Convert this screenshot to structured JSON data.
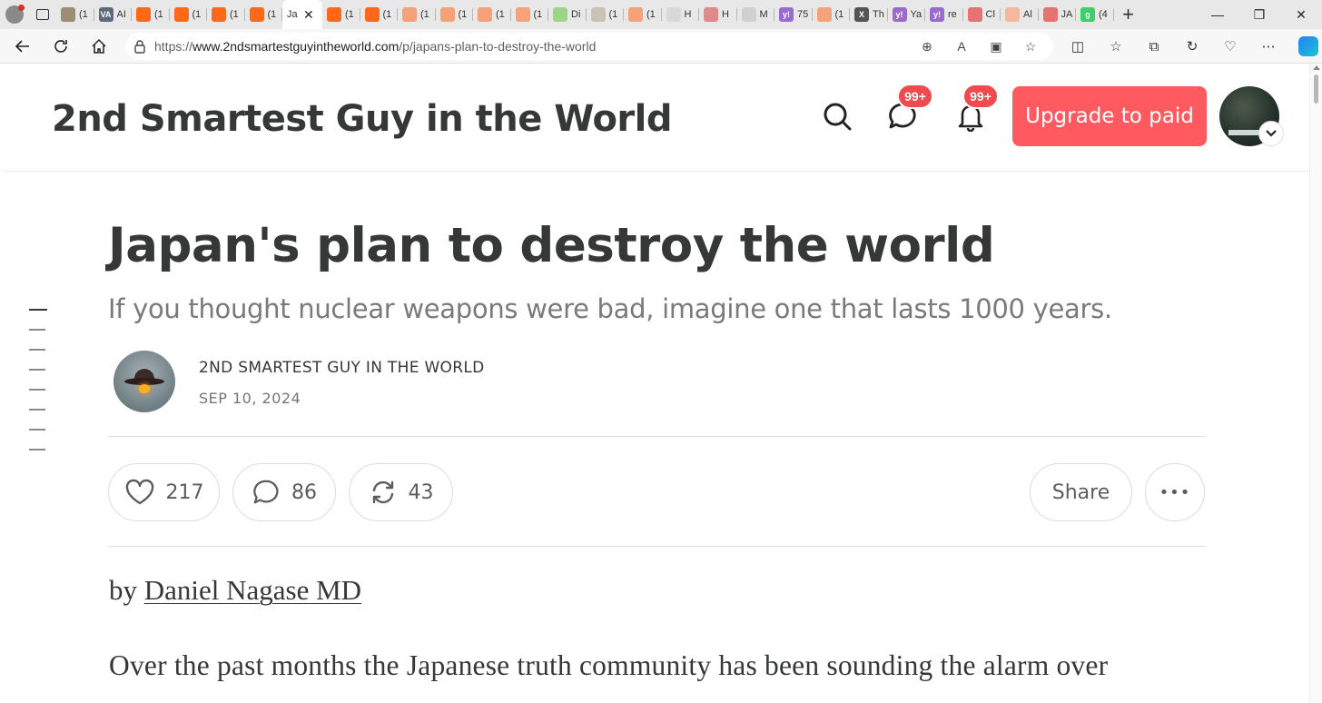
{
  "browser": {
    "tabs": [
      {
        "title": "(1",
        "favicon": "map-icon",
        "color": "#9a8f75"
      },
      {
        "title": "AI",
        "favicon": "va-icon",
        "color": "#5b6b7a",
        "text": "VA"
      },
      {
        "title": "(1",
        "favicon": "substack-icon",
        "color": "#ff6719"
      },
      {
        "title": "(1",
        "favicon": "substack-icon",
        "color": "#ff6719"
      },
      {
        "title": "(1",
        "favicon": "substack-icon",
        "color": "#ff6719"
      },
      {
        "title": "(1",
        "favicon": "substack-icon",
        "color": "#ff6719"
      },
      {
        "title": "Ja",
        "favicon": "",
        "color": "",
        "active": true
      },
      {
        "title": "(1",
        "favicon": "substack-icon",
        "color": "#ff6719"
      },
      {
        "title": "(1",
        "favicon": "substack-icon",
        "color": "#ff6719"
      },
      {
        "title": "(1",
        "favicon": "substack-icon",
        "color": "#f5a27a"
      },
      {
        "title": "(1",
        "favicon": "substack-icon",
        "color": "#f5a27a"
      },
      {
        "title": "(1",
        "favicon": "substack-icon",
        "color": "#f5a27a"
      },
      {
        "title": "(1",
        "favicon": "substack-icon",
        "color": "#f5a27a"
      },
      {
        "title": "Di",
        "favicon": "play-icon",
        "color": "#9cd48a"
      },
      {
        "title": "(1",
        "favicon": "person-icon",
        "color": "#c9c2b5"
      },
      {
        "title": "(1",
        "favicon": "substack-icon",
        "color": "#f5a27a"
      },
      {
        "title": "H",
        "favicon": "page-icon",
        "color": "#d8d8d8"
      },
      {
        "title": "H",
        "favicon": "video-icon",
        "color": "#e08a8a"
      },
      {
        "title": "M",
        "favicon": "search-icon",
        "color": "#d0d0d0"
      },
      {
        "title": "75",
        "favicon": "yahoo-icon",
        "color": "#9b6ad0",
        "text": "y!"
      },
      {
        "title": "(1",
        "favicon": "substack-icon",
        "color": "#f5a27a"
      },
      {
        "title": "Th",
        "favicon": "x-icon",
        "color": "#555555",
        "text": "X"
      },
      {
        "title": "Ya",
        "favicon": "yahoo-icon",
        "color": "#9b6ad0",
        "text": "y!"
      },
      {
        "title": "re",
        "favicon": "yahoo-icon",
        "color": "#9b6ad0",
        "text": "y!"
      },
      {
        "title": "Cl",
        "favicon": "youtube-icon",
        "color": "#e57373"
      },
      {
        "title": "Al",
        "favicon": "bookmark-icon",
        "color": "#f2b8a0"
      },
      {
        "title": "JA",
        "favicon": "youtube-icon",
        "color": "#e57373"
      },
      {
        "title": "(4",
        "favicon": "g-icon",
        "color": "#3ecf6a",
        "text": "g"
      }
    ],
    "active_tab_close": "✕",
    "new_tab": "+",
    "url_prefix": "https://",
    "url_domain": "www.2ndsmartestguyintheworld.com",
    "url_path": "/p/japans-plan-to-destroy-the-world"
  },
  "header": {
    "publication_name": "2nd Smartest Guy in the World",
    "chat_badge": "99+",
    "notifications_badge": "99+",
    "upgrade_label": "Upgrade to paid"
  },
  "post": {
    "title": "Japan's plan to destroy the world",
    "subtitle": "If you thought nuclear weapons were bad, imagine one that lasts 1000 years.",
    "author": "2ND SMARTEST GUY IN THE WORLD",
    "date": "SEP 10, 2024",
    "likes": "217",
    "comments": "86",
    "restacks": "43",
    "share_label": "Share",
    "more_label": "•••",
    "byline_prefix": "by",
    "byline_author": "Daniel Nagase MD",
    "first_paragraph": "Over the past months the Japanese truth community has been sounding the alarm over"
  },
  "colors": {
    "accent": "#ff5a5f",
    "badge": "#f04a4e",
    "text_dark": "#363737",
    "text_muted": "#7a7a7a"
  }
}
